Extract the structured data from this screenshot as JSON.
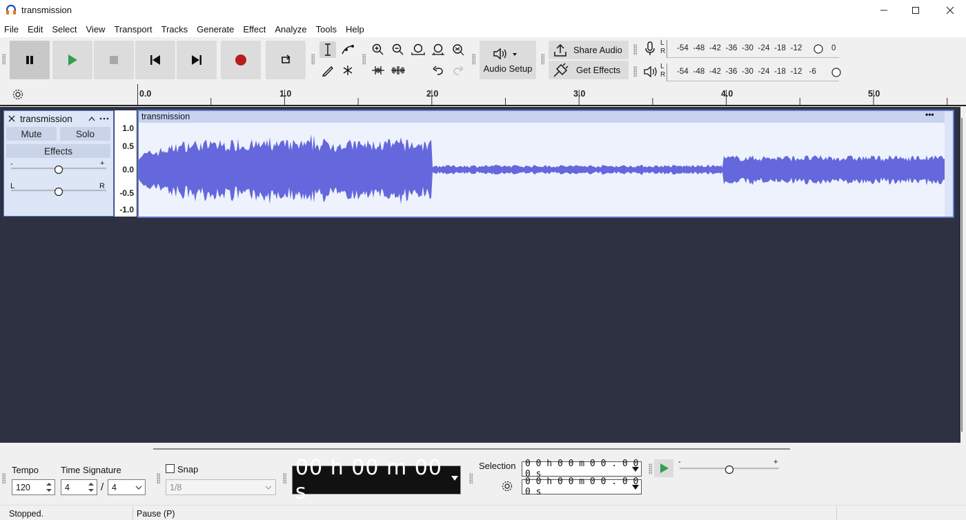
{
  "window": {
    "title": "transmission",
    "minimize_icon": "minimize-icon",
    "maximize_icon": "maximize-icon",
    "close_icon": "close-icon"
  },
  "menu": [
    "File",
    "Edit",
    "Select",
    "View",
    "Transport",
    "Tracks",
    "Generate",
    "Effect",
    "Analyze",
    "Tools",
    "Help"
  ],
  "toolbar": {
    "audio_setup_label": "Audio Setup",
    "share_audio_label": "Share Audio",
    "get_effects_label": "Get Effects",
    "record_meter": {
      "channels": [
        "L",
        "R"
      ],
      "scale": "-54  -48  -42  -36  -30  -24  -18  -12",
      "end_label": "0"
    },
    "play_meter": {
      "channels": [
        "L",
        "R"
      ],
      "scale": "-54  -48  -42  -36  -30  -24  -18  -12   -6"
    }
  },
  "ruler": {
    "labels": [
      "0.0",
      "1.0",
      "2.0",
      "3.0",
      "4.0",
      "5.0"
    ]
  },
  "track": {
    "name": "transmission",
    "mute_label": "Mute",
    "solo_label": "Solo",
    "effects_label": "Effects",
    "gain_min": "-",
    "gain_max": "+",
    "pan_left": "L",
    "pan_right": "R",
    "gain_level": 0.5,
    "pan_level": 0.5,
    "vruler": [
      "1.0",
      "0.5",
      "0.0",
      "-0.5",
      "-1.0"
    ],
    "clip_name": "transmission",
    "clip_menu": "•••",
    "waveform_color": "#6468dc"
  },
  "bottom": {
    "tempo_label": "Tempo",
    "tempo_value": "120",
    "time_signature_label": "Time Signature",
    "ts_numerator": "4",
    "ts_separator": "/",
    "ts_denominator": "4",
    "snap_label": "Snap",
    "snap_value": "1/8",
    "big_time": "00 h 00 m 00 s",
    "selection_label": "Selection",
    "selection_start": "0 0 h 0 0 m 0 0 . 0 0 0 s",
    "selection_end": "0 0 h 0 0 m 0 0 . 0 0 0 s",
    "play_speed_min": "-",
    "play_speed_max": "+",
    "play_speed_level": 0.5
  },
  "status": {
    "left": "Stopped.",
    "middle": "Pause (P)"
  }
}
